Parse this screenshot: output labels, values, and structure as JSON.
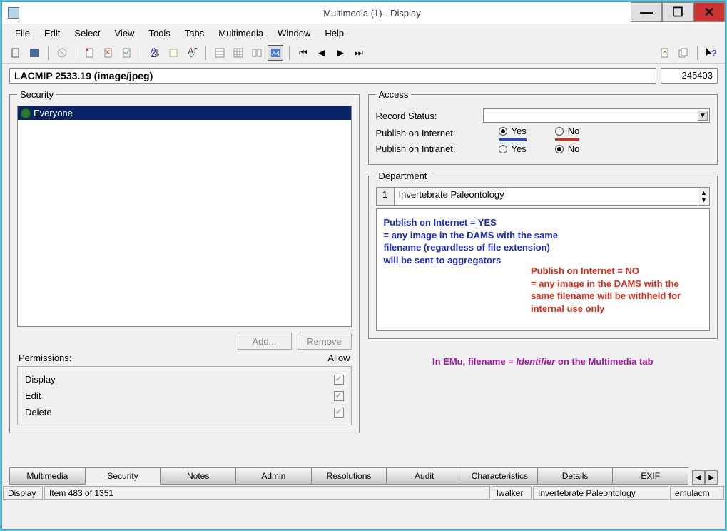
{
  "window": {
    "title": "Multimedia (1) - Display"
  },
  "menubar": [
    "File",
    "Edit",
    "Select",
    "View",
    "Tools",
    "Tabs",
    "Multimedia",
    "Window",
    "Help"
  ],
  "header": {
    "name": "LACMIP 2533.19 (image/jpeg)",
    "count": "245403"
  },
  "security": {
    "legend": "Security",
    "item": "Everyone",
    "add_btn": "Add...",
    "remove_btn": "Remove",
    "perm_header": "Permissions:",
    "allow_header": "Allow",
    "perms": [
      "Display",
      "Edit",
      "Delete"
    ]
  },
  "access": {
    "legend": "Access",
    "status_label": "Record Status:",
    "status_value": "",
    "pub_net_label": "Publish on Internet:",
    "pub_intra_label": "Publish on Intranet:",
    "yes": "Yes",
    "no": "No"
  },
  "department": {
    "legend": "Department",
    "idx": "1",
    "value": "Invertebrate Paleontology"
  },
  "annot": {
    "blue": "Publish on Internet = YES\n= any image in the DAMS with the same filename (regardless of file extension) will be sent to aggregators",
    "red": "Publish on Internet = NO\n= any image in the DAMS with the same filename will be withheld for internal use only",
    "purple_before": "In EMu, filename = ",
    "purple_ital": "Identifier",
    "purple_after": " on the Multimedia tab"
  },
  "tabs": [
    "Multimedia",
    "Security",
    "Notes",
    "Admin",
    "Resolutions",
    "Audit",
    "Characteristics",
    "Details",
    "EXIF"
  ],
  "active_tab": "Security",
  "status": {
    "mode": "Display",
    "item": "Item 483 of 1351",
    "user": "lwalker",
    "dept": "Invertebrate Paleontology",
    "host": "emulacm"
  }
}
